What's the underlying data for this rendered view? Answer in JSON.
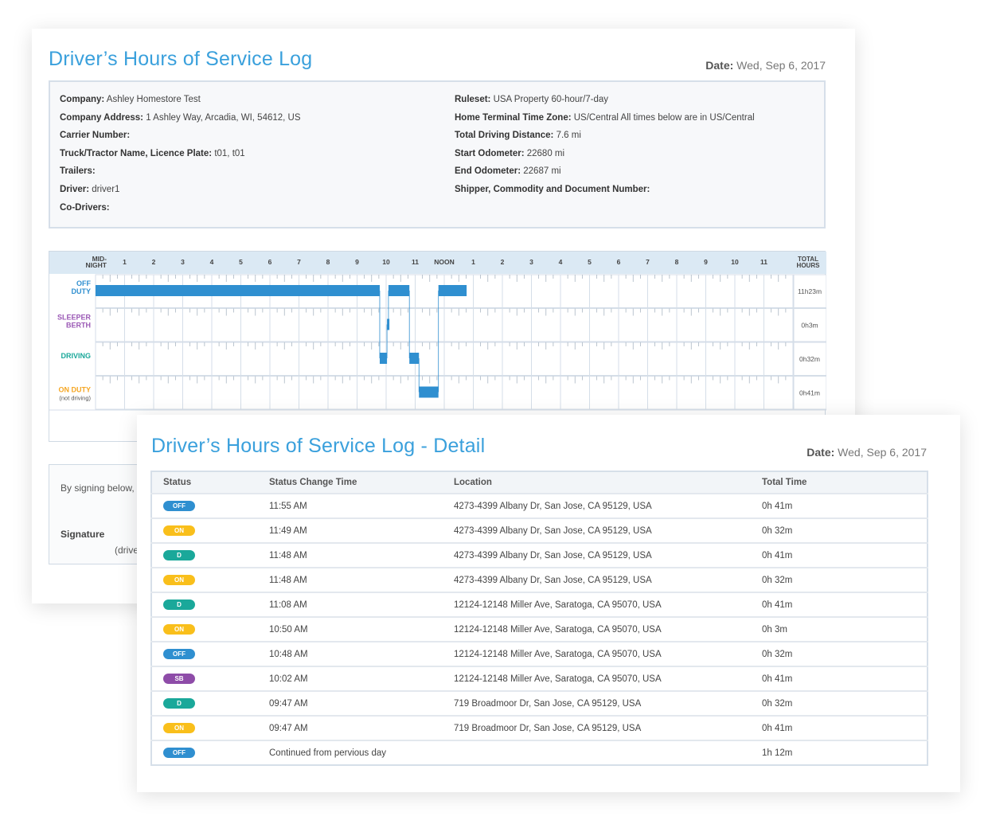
{
  "log": {
    "title": "Driver’s Hours of Service Log",
    "date_label": "Date:",
    "date_value": "Wed, Sep 6, 2017",
    "info_left": [
      {
        "label": "Company:",
        "value": "Ashley Homestore Test"
      },
      {
        "label": "Company Address:",
        "value": "1 Ashley Way, Arcadia, WI, 54612, US"
      },
      {
        "label": "Carrier Number:",
        "value": ""
      },
      {
        "label": "Truck/Tractor Name, Licence Plate:",
        "value": "t01, t01"
      },
      {
        "label": "Trailers:",
        "value": ""
      },
      {
        "label": "Driver:",
        "value": "driver1"
      },
      {
        "label": "Co-Drivers:",
        "value": ""
      }
    ],
    "info_right": [
      {
        "label": "Ruleset:",
        "value": "USA Property 60-hour/7-day"
      },
      {
        "label": "Home Terminal Time Zone:",
        "value": "US/Central All times below are in US/Central"
      },
      {
        "label": "Total Driving Distance:",
        "value": "7.6 mi"
      },
      {
        "label": "Start Odometer:",
        "value": "22680 mi"
      },
      {
        "label": "End Odometer:",
        "value": "22687 mi"
      },
      {
        "label": "Shipper, Commodity and Document Number:",
        "value": ""
      }
    ],
    "signature": {
      "statement": "By signing below, I",
      "label": "Signature",
      "sub": "(drive"
    }
  },
  "chart_data": {
    "type": "timeline",
    "hour_labels": [
      "MID-\nNIGHT",
      "1",
      "2",
      "3",
      "4",
      "5",
      "6",
      "7",
      "8",
      "9",
      "10",
      "11",
      "NOON",
      "1",
      "2",
      "3",
      "4",
      "5",
      "6",
      "7",
      "8",
      "9",
      "10",
      "11"
    ],
    "total_header": "TOTAL\nHOURS",
    "rows": [
      {
        "key": "off",
        "label": "OFF\nDUTY",
        "color": "#2f8fd0",
        "total": "11h23m"
      },
      {
        "key": "sb",
        "label": "SLEEPER\nBERTH",
        "color": "#9b59b6",
        "total": "0h3m"
      },
      {
        "key": "d",
        "label": "DRIVING",
        "color": "#1aa89a",
        "total": "0h32m"
      },
      {
        "key": "on",
        "label": "ON DUTY",
        "sublabel": "(not driving)",
        "color": "#f5a623",
        "total": "0h41m"
      }
    ],
    "bar_color": "#2f8fd0",
    "segments": [
      {
        "row": 0,
        "start": 0,
        "end": 9.78
      },
      {
        "row": 2,
        "start": 9.78,
        "end": 10.03
      },
      {
        "row": 1,
        "start": 10.03,
        "end": 10.08
      },
      {
        "row": 0,
        "start": 10.08,
        "end": 10.8
      },
      {
        "row": 2,
        "start": 10.8,
        "end": 11.13
      },
      {
        "row": 3,
        "start": 11.13,
        "end": 11.8
      },
      {
        "row": 0,
        "start": 11.8,
        "end": 12.77
      }
    ]
  },
  "detail": {
    "title": "Driver’s Hours of Service Log - Detail",
    "date_label": "Date:",
    "date_value": "Wed, Sep 6, 2017",
    "columns": [
      "Status",
      "Status Change Time",
      "Location",
      "Total Time"
    ],
    "status_colors": {
      "OFF": "#2f8fd0",
      "ON": "#f9bf1b",
      "D": "#1aa89a",
      "SB": "#8e4ca8"
    },
    "rows": [
      {
        "status": "OFF",
        "time": "11:55 AM",
        "location": "4273-4399 Albany Dr, San Jose, CA 95129, USA",
        "total": "0h 41m"
      },
      {
        "status": "ON",
        "time": "11:49 AM",
        "location": "4273-4399 Albany Dr, San Jose, CA 95129, USA",
        "total": "0h 32m"
      },
      {
        "status": "D",
        "time": "11:48 AM",
        "location": "4273-4399 Albany Dr, San Jose, CA 95129, USA",
        "total": "0h 41m"
      },
      {
        "status": "ON",
        "time": "11:48 AM",
        "location": "4273-4399 Albany Dr, San Jose, CA 95129, USA",
        "total": "0h 32m"
      },
      {
        "status": "D",
        "time": "11:08 AM",
        "location": "12124-12148 Miller Ave, Saratoga, CA 95070, USA",
        "total": "0h 41m"
      },
      {
        "status": "ON",
        "time": "10:50 AM",
        "location": "12124-12148 Miller Ave, Saratoga, CA 95070, USA",
        "total": "0h 3m"
      },
      {
        "status": "OFF",
        "time": "10:48 AM",
        "location": "12124-12148 Miller Ave, Saratoga, CA 95070, USA",
        "total": "0h 32m"
      },
      {
        "status": "SB",
        "time": "10:02 AM",
        "location": "12124-12148 Miller Ave, Saratoga, CA 95070, USA",
        "total": "0h 41m"
      },
      {
        "status": "D",
        "time": "09:47 AM",
        "location": "719 Broadmoor Dr, San Jose, CA 95129, USA",
        "total": "0h 32m"
      },
      {
        "status": "ON",
        "time": "09:47 AM",
        "location": "719 Broadmoor Dr, San Jose, CA 95129, USA",
        "total": "0h 41m"
      },
      {
        "status": "OFF",
        "time": "Continued from pervious day",
        "location": "",
        "total": "1h 12m"
      }
    ]
  }
}
